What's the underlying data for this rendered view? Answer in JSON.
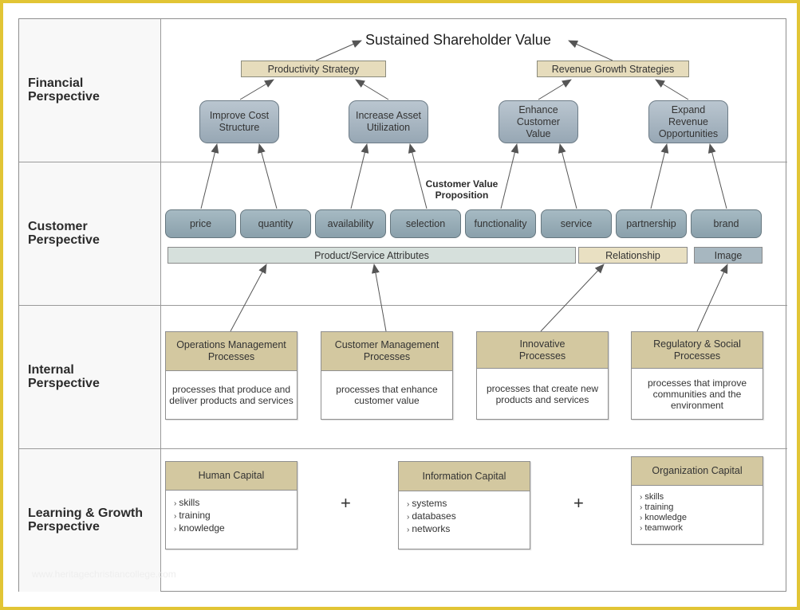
{
  "lanes": [
    {
      "label": "Financial\nPerspective"
    },
    {
      "label": "Customer\nPerspective"
    },
    {
      "label": "Internal\nPerspective"
    },
    {
      "label": "Learning & Growth\nPerspective"
    }
  ],
  "financial": {
    "title": "Sustained Shareholder Value",
    "strategies": [
      "Productivity Strategy",
      "Revenue Growth Strategies"
    ],
    "objectives": [
      "Improve Cost\nStructure",
      "Increase Asset\nUtilization",
      "Enhance\nCustomer\nValue",
      "Expand\nRevenue\nOpportunities"
    ]
  },
  "customer": {
    "value_proposition_label": "Customer Value\nProposition",
    "attributes": [
      "price",
      "quantity",
      "availability",
      "selection",
      "functionality",
      "service",
      "partnership",
      "brand"
    ],
    "groups": [
      "Product/Service Attributes",
      "Relationship",
      "Image"
    ]
  },
  "internal": {
    "processes": [
      {
        "title": "Operations Management\nProcesses",
        "description": "processes that produce and\ndeliver products and services"
      },
      {
        "title": "Customer Management\nProcesses",
        "description": "processes that enhance\ncustomer value"
      },
      {
        "title": "Innovative\nProcesses",
        "description": "processes that create new\nproducts and services"
      },
      {
        "title": "Regulatory & Social\nProcesses",
        "description": "processes that improve\ncommunities and the\nenvironment"
      }
    ]
  },
  "learning": {
    "capitals": [
      {
        "title": "Human Capital",
        "items": [
          "skills",
          "training",
          "knowledge"
        ]
      },
      {
        "title": "Information Capital",
        "items": [
          "systems",
          "databases",
          "networks"
        ]
      },
      {
        "title": "Organization Capital",
        "items": [
          "skills",
          "training",
          "knowledge",
          "teamwork"
        ]
      }
    ],
    "operator": "+"
  },
  "watermark": "www.heritagechristiancollege.com",
  "colors": {
    "border_accent": "#e2c535",
    "strategy_fill": "#e6dcbc",
    "card_header_fill": "#d3c8a0",
    "objective_fill": "#a9b7c3",
    "attribute_fill": "#98adb7",
    "product_bar_fill": "#d6e0dc",
    "relationship_bar_fill": "#e9e0c2",
    "image_bar_fill": "#a7b7c0"
  }
}
